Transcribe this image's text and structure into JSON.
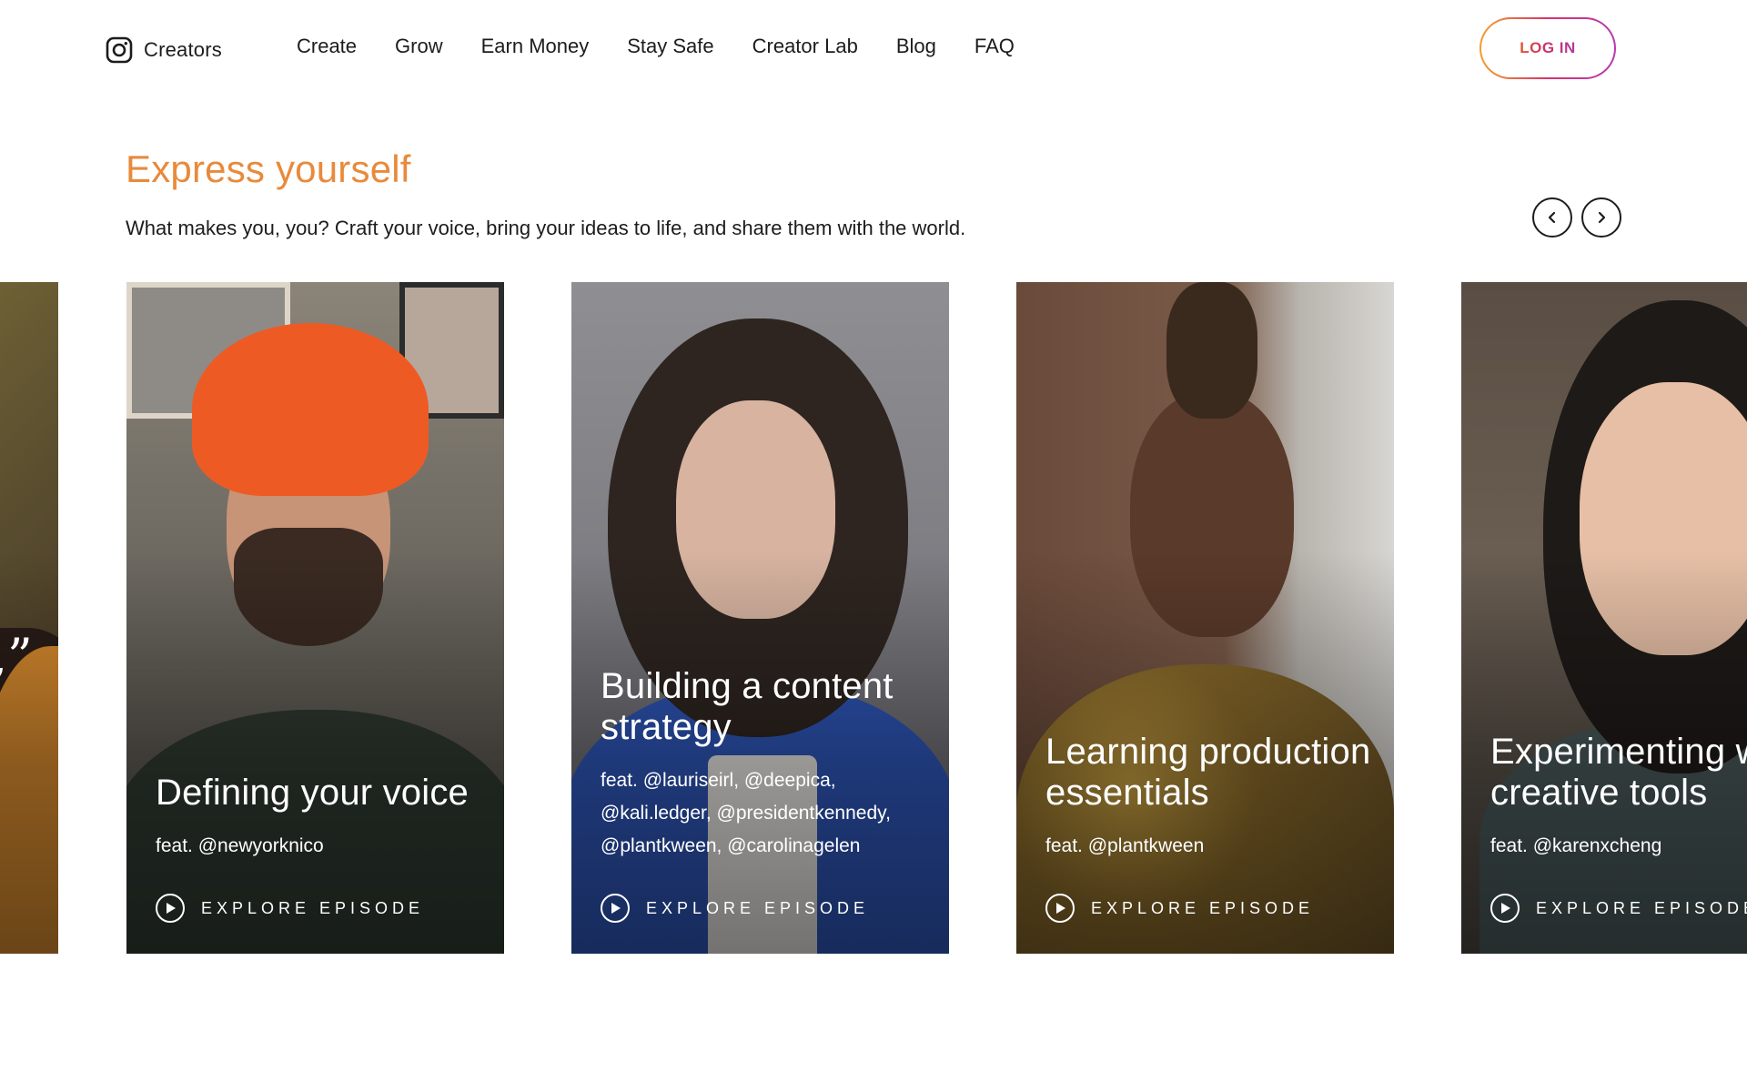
{
  "header": {
    "brand_label": "Creators",
    "nav": [
      "Create",
      "Grow",
      "Earn Money",
      "Stay Safe",
      "Creator Lab",
      "Blog",
      "FAQ"
    ],
    "login_label": "LOG IN"
  },
  "section": {
    "title": "Express yourself",
    "description": "What makes you, you? Craft your voice, bring your ideas to life, and share them with the world."
  },
  "cards": [
    {
      "title": "Defining your voice",
      "feat": "feat. @newyorknico",
      "cta": "EXPLORE EPISODE"
    },
    {
      "title": "Building a content strategy",
      "feat": "feat. @lauriseirl, @deepica, @kali.ledger, @presidentkennedy, @plantkween, @carolinagelen",
      "cta": "EXPLORE EPISODE"
    },
    {
      "title": "Learning production essentials",
      "feat": "feat. @plantkween",
      "cta": "EXPLORE EPISODE"
    },
    {
      "title": "Experimenting with creative tools",
      "feat": "feat. @karenxcheng",
      "cta": "EXPLORE EPISODE"
    }
  ],
  "partial_card_quote": ",”",
  "colors": {
    "title_orange": "#e88a3c",
    "login_gradient": [
      "#f59e2b",
      "#d9326a",
      "#b43bb0"
    ]
  }
}
